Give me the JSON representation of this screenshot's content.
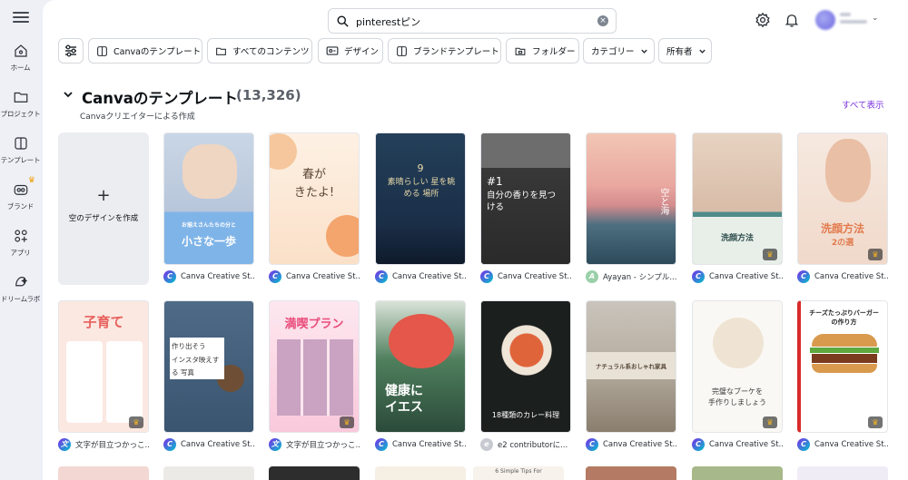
{
  "rail": {
    "items": [
      {
        "label": "ホーム",
        "icon": "home-icon"
      },
      {
        "label": "プロジェクト",
        "icon": "folder-icon"
      },
      {
        "label": "テンプレート",
        "icon": "template-icon"
      },
      {
        "label": "ブランド",
        "icon": "brand-icon"
      },
      {
        "label": "アプリ",
        "icon": "apps-icon"
      },
      {
        "label": "ドリームラボ",
        "icon": "dream-lab-icon"
      }
    ]
  },
  "search": {
    "value": "pinterestピン"
  },
  "filters": {
    "chips": [
      "Canvaのテンプレート",
      "すべてのコンテンツ",
      "デザイン",
      "ブランドテンプレート",
      "フォルダー",
      "カテゴリー",
      "所有者"
    ]
  },
  "section": {
    "title": "Canvaのテンプレート",
    "count": "(13,326)",
    "subtitle": "Canvaクリエイターによる作成",
    "see_all": "すべて表示",
    "blank_label": "空のデザインを作成",
    "blank_plus": "+"
  },
  "row1": [
    {
      "author": "Canva Creative St...",
      "text1": "お揃えさんたちの分と",
      "text2": "小さな一歩",
      "logo": "C"
    },
    {
      "author": "Canva Creative St...",
      "text1": "春が",
      "text2": "きたよ!",
      "logo": "C"
    },
    {
      "author": "Canva Creative St...",
      "text1": "9",
      "text2": "素晴らしい 星を眺める 場所",
      "logo": "C"
    },
    {
      "author": "Canva Creative St...",
      "text1": "#1",
      "text2": "自分の香りを見つける",
      "logo": "C"
    },
    {
      "author": "Ayayan - シンプル...",
      "text1": "空と海",
      "text2": "",
      "logo": "A"
    },
    {
      "author": "Canva Creative St...",
      "text1": "洗顔方法",
      "text2": "",
      "logo": "C"
    },
    {
      "author": "Canva Creative St...",
      "text1": "洗顔方法",
      "text2": "2の選",
      "logo": "C"
    }
  ],
  "row2": [
    {
      "author": "文字が目立つかっこ...",
      "text1": "子育て",
      "text2": "",
      "logo": "文"
    },
    {
      "author": "Canva Creative St...",
      "text1": "作り出そう",
      "text2": "インスタ映えする 写真",
      "logo": "C"
    },
    {
      "author": "文字が目立つかっこ...",
      "text1": "満喫プラン",
      "text2": "",
      "logo": "文"
    },
    {
      "author": "Canva Creative St...",
      "text1": "健康に",
      "text2": "イエス",
      "logo": "C"
    },
    {
      "author": "e2 contributorに...",
      "text1": "18種類のカレー料理",
      "text2": "",
      "logo": "e"
    },
    {
      "author": "Canva Creative St...",
      "text1": "ナチュラル系おしゃれ家具",
      "text2": "",
      "logo": "C"
    },
    {
      "author": "Canva Creative St...",
      "text1": "完璧なブーケを",
      "text2": "手作りしましょう",
      "logo": "C"
    },
    {
      "author": "Canva Creative St...",
      "text1": "チーズたっぷりバーガー",
      "text2": "の作り方",
      "logo": "C"
    }
  ],
  "peek_row": {
    "text": "6 Simple Tips For"
  }
}
